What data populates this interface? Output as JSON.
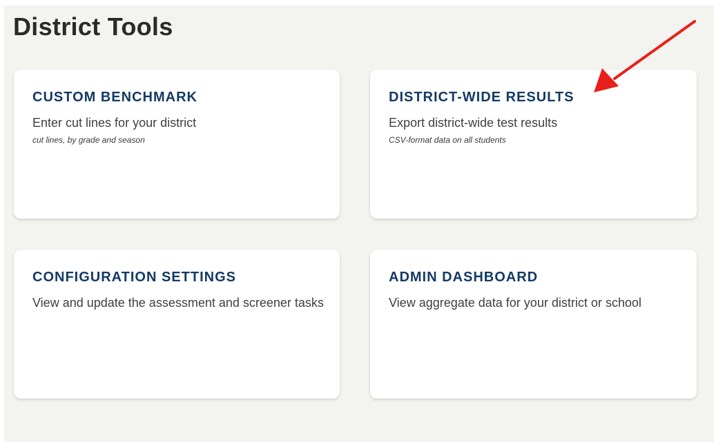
{
  "page": {
    "title": "District Tools"
  },
  "cards": [
    {
      "title": "CUSTOM BENCHMARK",
      "description": "Enter cut lines for your district",
      "note": "cut lines, by grade and season"
    },
    {
      "title": "DISTRICT-WIDE RESULTS",
      "description": "Export district-wide test results",
      "note": "CSV-format data on all students"
    },
    {
      "title": "CONFIGURATION SETTINGS",
      "description": "View and update the assessment and screener tasks",
      "note": ""
    },
    {
      "title": "ADMIN DASHBOARD",
      "description": "View aggregate data for your district or school",
      "note": ""
    }
  ],
  "annotation": {
    "arrow_color": "#e8201b",
    "arrow_icon": "arrow-pointer-icon"
  },
  "colors": {
    "panel_background": "#f3f3ef",
    "card_title": "#133a64",
    "page_title": "#2a2a2a"
  }
}
